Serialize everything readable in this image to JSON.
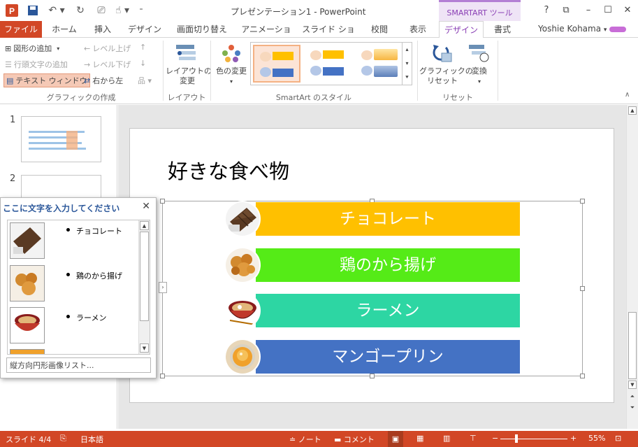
{
  "app": {
    "title": "プレゼンテーション1 - PowerPoint",
    "contextual_tab": "SMARTART ツール",
    "user": "Yoshie Kohama"
  },
  "tabs": [
    "ファイル",
    "ホーム",
    "挿入",
    "デザイン",
    "画面切り替え",
    "アニメーション",
    "スライド ショー",
    "校閲",
    "表示",
    "デザイン",
    "書式"
  ],
  "ribbon": {
    "create_graphic": {
      "add_shape": "図形の追加",
      "add_bullet": "行頭文字の追加",
      "text_pane": "テキスト ウィンドウ",
      "promote": "レベル上げ",
      "demote": "レベル下げ",
      "rtl": "右から左",
      "label": "グラフィックの作成"
    },
    "layout": {
      "change_layout": "レイアウトの\n変更",
      "label": "レイアウト"
    },
    "styles": {
      "change_colors": "色の変更",
      "label": "SmartArt のスタイル"
    },
    "reset": {
      "reset_graphic": "グラフィックの\nリセット",
      "convert": "変換",
      "label": "リセット"
    }
  },
  "thumbnails": [
    "1",
    "2"
  ],
  "slide": {
    "title": "好きな食べ物",
    "items": [
      {
        "label": "チョコレート",
        "color": "#FFC000",
        "icon": "chocolate-photo"
      },
      {
        "label": "鶏のから揚げ",
        "color": "#55EB17",
        "icon": "fried-chicken-photo"
      },
      {
        "label": "ラーメン",
        "color": "#2DD6A3",
        "icon": "ramen-photo"
      },
      {
        "label": "マンゴープリン",
        "color": "#4472C4",
        "icon": "mango-pudding-photo"
      }
    ]
  },
  "text_pane": {
    "title": "ここに文字を入力してください",
    "items": [
      "チョコレート",
      "鶏のから揚げ",
      "ラーメン"
    ],
    "footer": "縦方向円形画像リスト..."
  },
  "status": {
    "slide": "スライド 4/4",
    "language": "日本語",
    "notes": "ノート",
    "comments": "コメント",
    "zoom": "55%"
  },
  "colors": {
    "accent": "#D24726",
    "contextual": "#8A3FB5"
  }
}
